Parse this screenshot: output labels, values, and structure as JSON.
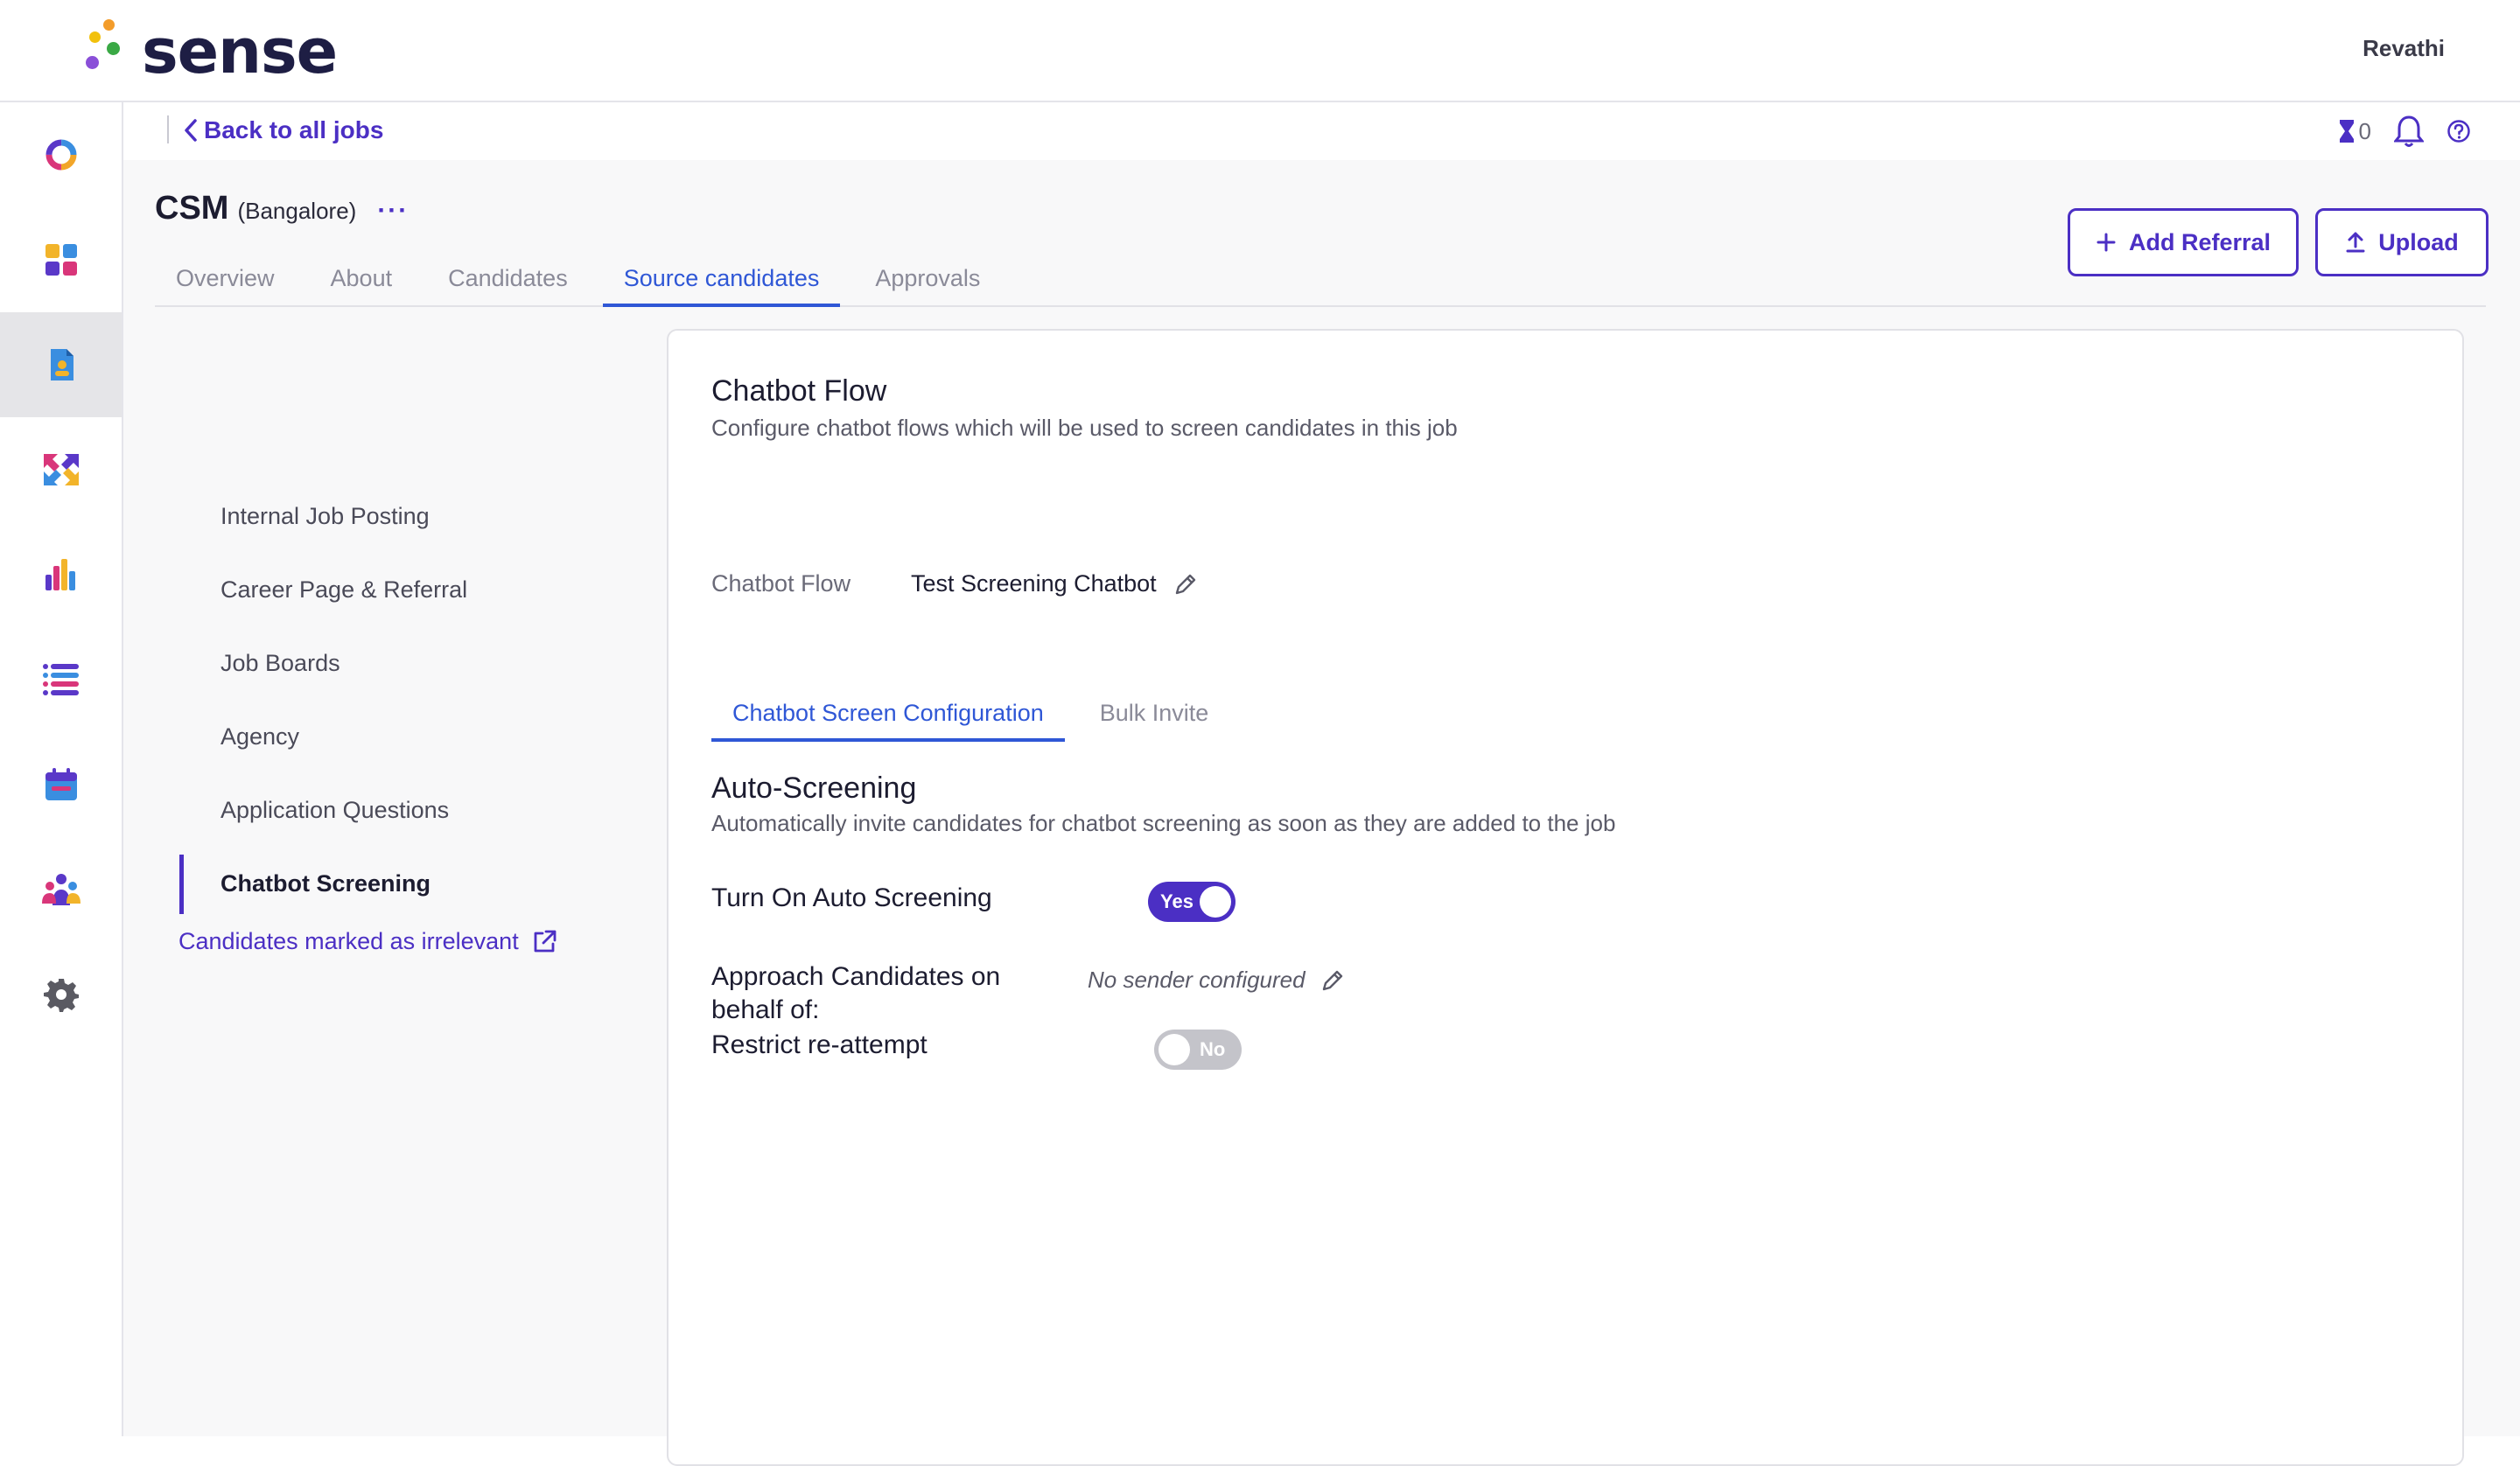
{
  "brand": {
    "name": "sense"
  },
  "user": {
    "name": "Revathi"
  },
  "sidebar": {
    "items": [
      {
        "icon": "donut-icon"
      },
      {
        "icon": "dashboard-grid-icon"
      },
      {
        "icon": "jobs-document-icon",
        "active": true
      },
      {
        "icon": "engage-arrows-icon"
      },
      {
        "icon": "analytics-bar-icon"
      },
      {
        "icon": "list-icon"
      },
      {
        "icon": "calendar-icon"
      },
      {
        "icon": "people-icon"
      },
      {
        "icon": "gear-icon"
      }
    ]
  },
  "header": {
    "back_label": "Back to all jobs",
    "hourglass_count": "0",
    "job_name": "CSM",
    "job_location": "(Bangalore)",
    "more_label": "···"
  },
  "tabs": [
    {
      "label": "Overview"
    },
    {
      "label": "About"
    },
    {
      "label": "Candidates"
    },
    {
      "label": "Source candidates",
      "active": true
    },
    {
      "label": "Approvals"
    }
  ],
  "actions": {
    "add_referral": "Add Referral",
    "upload": "Upload"
  },
  "left_nav": {
    "items": [
      {
        "label": "Internal Job Posting"
      },
      {
        "label": "Career Page & Referral"
      },
      {
        "label": "Job Boards"
      },
      {
        "label": "Agency"
      },
      {
        "label": "Application Questions"
      },
      {
        "label": "Chatbot Screening",
        "active": true
      }
    ],
    "irrelevant_link": "Candidates marked as irrelevant"
  },
  "chatbot": {
    "title": "Chatbot Flow",
    "subtitle": "Configure chatbot flows which will be used to screen candidates in this job",
    "flow_label": "Chatbot Flow",
    "flow_value": "Test Screening Chatbot",
    "inner_tabs": [
      {
        "label": "Chatbot Screen Configuration",
        "active": true
      },
      {
        "label": "Bulk Invite"
      }
    ],
    "auto_title": "Auto-Screening",
    "auto_subtitle": "Automatically invite candidates for chatbot screening as soon as they are added to the job",
    "auto_toggle_label": "Turn On Auto Screening",
    "auto_toggle_value": "Yes",
    "approach_label_1": "Approach Candidates on",
    "approach_label_2": "behalf of:",
    "sender_value": "No sender configured",
    "restrict_label": "Restrict re-attempt",
    "restrict_toggle_value": "No"
  },
  "colors": {
    "accent": "#4b2fc4",
    "tab_active": "#2f57d6",
    "toggle_off": "#c4c4ca"
  }
}
